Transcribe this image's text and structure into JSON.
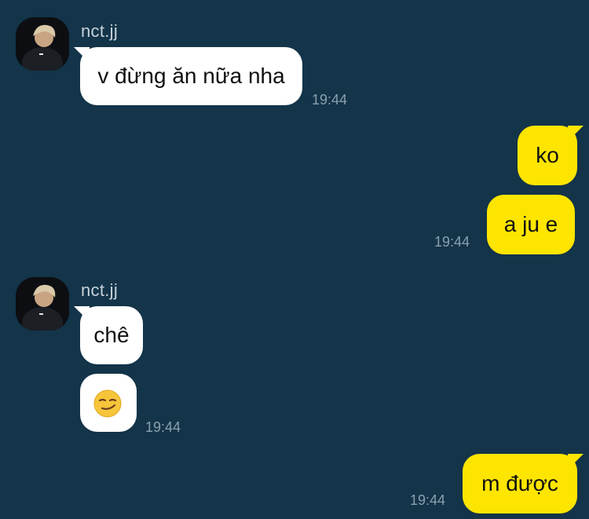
{
  "chat": {
    "messages": [
      {
        "sender": "nct.jj",
        "text": "v đừng ăn nữa nha",
        "time": "19:44"
      },
      {
        "text": "ko"
      },
      {
        "text": "a ju e",
        "time": "19:44"
      },
      {
        "sender": "nct.jj",
        "text": "chê"
      },
      {
        "emoji": "smirking-face-emoji",
        "time": "19:44"
      },
      {
        "text": "m được",
        "time": "19:44"
      }
    ]
  },
  "colors": {
    "background": "#133449",
    "incoming_bubble": "#ffffff",
    "outgoing_bubble": "#fee500",
    "timestamp": "#8aa0ae",
    "sender_name": "#c7d2da"
  }
}
